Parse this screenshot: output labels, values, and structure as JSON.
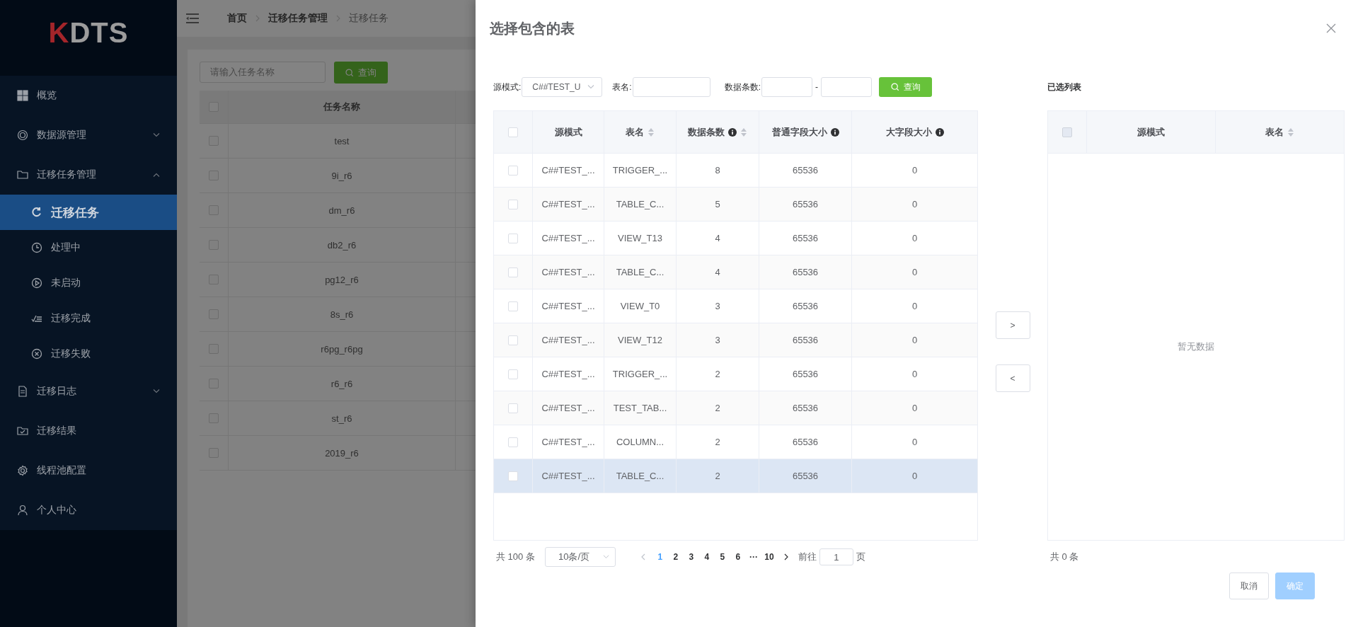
{
  "logo": {
    "mark": "K",
    "text": "DTS"
  },
  "sidebar": {
    "items": [
      {
        "label": "概览",
        "selected": false
      },
      {
        "label": "数据源管理",
        "selected": false,
        "expanded": false
      },
      {
        "label": "迁移任务管理",
        "selected": false,
        "expanded": true,
        "children": [
          {
            "label": "迁移任务",
            "selected": true
          },
          {
            "label": "处理中",
            "selected": false
          },
          {
            "label": "未启动",
            "selected": false
          },
          {
            "label": "迁移完成",
            "selected": false
          },
          {
            "label": "迁移失败",
            "selected": false
          }
        ]
      },
      {
        "label": "迁移日志",
        "selected": false,
        "expanded": false
      },
      {
        "label": "迁移结果",
        "selected": false
      },
      {
        "label": "线程池配置",
        "selected": false
      },
      {
        "label": "个人中心",
        "selected": false
      }
    ]
  },
  "breadcrumbs": [
    "首页",
    "迁移任务管理",
    "迁移任务"
  ],
  "task_search": {
    "placeholder": "请输入任务名称",
    "button": "查询"
  },
  "task_table": {
    "header_checked": false,
    "columns": [
      "任务名称"
    ],
    "rows": [
      {
        "name": "test",
        "checked": false
      },
      {
        "name": "9i_r6",
        "checked": false
      },
      {
        "name": "dm_r6",
        "checked": false
      },
      {
        "name": "db2_r6",
        "checked": false
      },
      {
        "name": "pg12_r6",
        "checked": false
      },
      {
        "name": "8s_r6",
        "checked": false
      },
      {
        "name": "r6pg_r6pg",
        "checked": false
      },
      {
        "name": "r6_r6",
        "checked": false
      },
      {
        "name": "st_r6",
        "checked": false
      },
      {
        "name": "2019_r6",
        "checked": false
      }
    ]
  },
  "dialog": {
    "title": "选择包含的表",
    "filters": {
      "schema_label": "源模式:",
      "schema_value": "C##TEST_U",
      "table_label": "表名:",
      "count_label": "数据条数:",
      "range_separator": "-",
      "query_button": "查询"
    },
    "source_table": {
      "header_checkbox": {
        "checked": false
      },
      "columns": [
        {
          "label": "源模式"
        },
        {
          "label": "表名",
          "sortable": true
        },
        {
          "label": "数据条数",
          "sortable": true,
          "info": true
        },
        {
          "label": "普通字段大小",
          "info": true
        },
        {
          "label": "大字段大小",
          "info": true
        }
      ],
      "rows": [
        {
          "schema": "C##TEST_...",
          "table": "TRIGGER_...",
          "count": "8",
          "normal_size": "65536",
          "large_size": "0",
          "checked": false,
          "highlighted": false
        },
        {
          "schema": "C##TEST_...",
          "table": "TABLE_C...",
          "count": "5",
          "normal_size": "65536",
          "large_size": "0",
          "checked": false,
          "highlighted": false
        },
        {
          "schema": "C##TEST_...",
          "table": "VIEW_T13",
          "count": "4",
          "normal_size": "65536",
          "large_size": "0",
          "checked": false,
          "highlighted": false
        },
        {
          "schema": "C##TEST_...",
          "table": "TABLE_C...",
          "count": "4",
          "normal_size": "65536",
          "large_size": "0",
          "checked": false,
          "highlighted": false
        },
        {
          "schema": "C##TEST_...",
          "table": "VIEW_T0",
          "count": "3",
          "normal_size": "65536",
          "large_size": "0",
          "checked": false,
          "highlighted": false
        },
        {
          "schema": "C##TEST_...",
          "table": "VIEW_T12",
          "count": "3",
          "normal_size": "65536",
          "large_size": "0",
          "checked": false,
          "highlighted": false
        },
        {
          "schema": "C##TEST_...",
          "table": "TRIGGER_...",
          "count": "2",
          "normal_size": "65536",
          "large_size": "0",
          "checked": false,
          "highlighted": false
        },
        {
          "schema": "C##TEST_...",
          "table": "TEST_TAB...",
          "count": "2",
          "normal_size": "65536",
          "large_size": "0",
          "checked": false,
          "highlighted": false
        },
        {
          "schema": "C##TEST_...",
          "table": "COLUMN...",
          "count": "2",
          "normal_size": "65536",
          "large_size": "0",
          "checked": false,
          "highlighted": false
        },
        {
          "schema": "C##TEST_...",
          "table": "TABLE_C...",
          "count": "2",
          "normal_size": "65536",
          "large_size": "0",
          "checked": false,
          "highlighted": true
        }
      ]
    },
    "pagination": {
      "total": "共 100 条",
      "page_size": "10条/页",
      "prev": {
        "disabled": true
      },
      "next": {
        "disabled": false
      },
      "pages": [
        {
          "label": "1",
          "selected": true
        },
        {
          "label": "2",
          "selected": false
        },
        {
          "label": "3",
          "selected": false
        },
        {
          "label": "4",
          "selected": false
        },
        {
          "label": "5",
          "selected": false
        },
        {
          "label": "6",
          "selected": false
        },
        {
          "label": "···",
          "selected": false
        },
        {
          "label": "10",
          "selected": false
        }
      ],
      "goto_label": "前往",
      "goto_value": "1",
      "goto_suffix": "页"
    },
    "transfer_buttons": [
      ">",
      "<"
    ],
    "selected_list": {
      "title": "已选列表",
      "header_checkbox": {
        "disabled": true
      },
      "columns": [
        {
          "label": "源模式"
        },
        {
          "label": "表名",
          "sortable": true
        }
      ],
      "empty_text": "暂无数据",
      "total": "共 0 条"
    },
    "buttons": [
      {
        "label": "取消",
        "disabled": false
      },
      {
        "label": "确定",
        "disabled": true
      }
    ]
  }
}
